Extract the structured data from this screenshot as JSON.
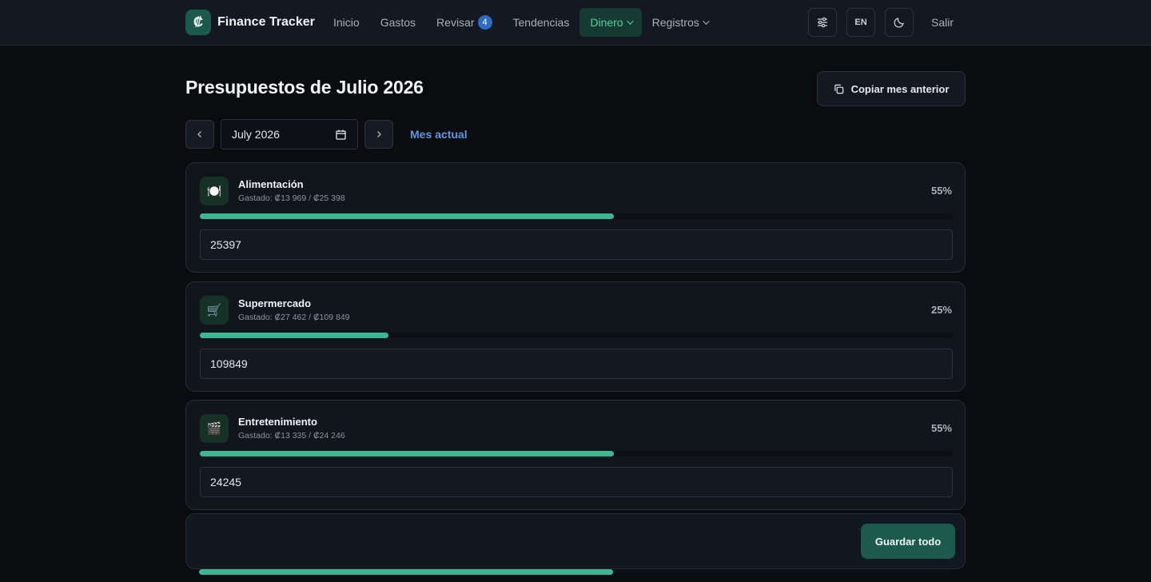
{
  "app": {
    "logo_glyph": "₡",
    "name": "Finance Tracker"
  },
  "nav": {
    "items": [
      {
        "label": "Inicio"
      },
      {
        "label": "Gastos"
      },
      {
        "label": "Revisar",
        "badge": "4"
      },
      {
        "label": "Tendencias"
      },
      {
        "label": "Dinero",
        "active": true,
        "dropdown": true
      },
      {
        "label": "Registros",
        "dropdown": true
      }
    ],
    "settings_icon": "sliders-icon",
    "language": "EN",
    "theme_icon": "moon-icon",
    "logout": "Salir"
  },
  "page": {
    "title": "Presupuestos de Julio 2026",
    "copy_button": "Copiar mes anterior",
    "month_value": "July 2026",
    "current_month_link": "Mes actual"
  },
  "budgets": [
    {
      "icon": "🍽️",
      "icon_name": "plate-icon",
      "name": "Alimentación",
      "spent": "Gastado: ₡13 969 / ₡25 398",
      "percent_label": "55%",
      "progress": 0.55,
      "input_value": "25397"
    },
    {
      "icon": "🛒",
      "icon_name": "cart-icon",
      "name": "Supermercado",
      "spent": "Gastado: ₡27 462 / ₡109 849",
      "percent_label": "25%",
      "progress": 0.25,
      "input_value": "109849"
    },
    {
      "icon": "🎬",
      "icon_name": "clapperboard-icon",
      "name": "Entretenimiento",
      "spent": "Gastado: ₡13 335 / ₡24 246",
      "percent_label": "55%",
      "progress": 0.55,
      "input_value": "24245"
    }
  ],
  "save_all": "Guardar todo",
  "partial_next_progress": 0.55,
  "colors": {
    "accent": "#3bb890",
    "brand": "#1d5a4b",
    "link": "#5a98e0",
    "badge": "#2e6cc2"
  }
}
